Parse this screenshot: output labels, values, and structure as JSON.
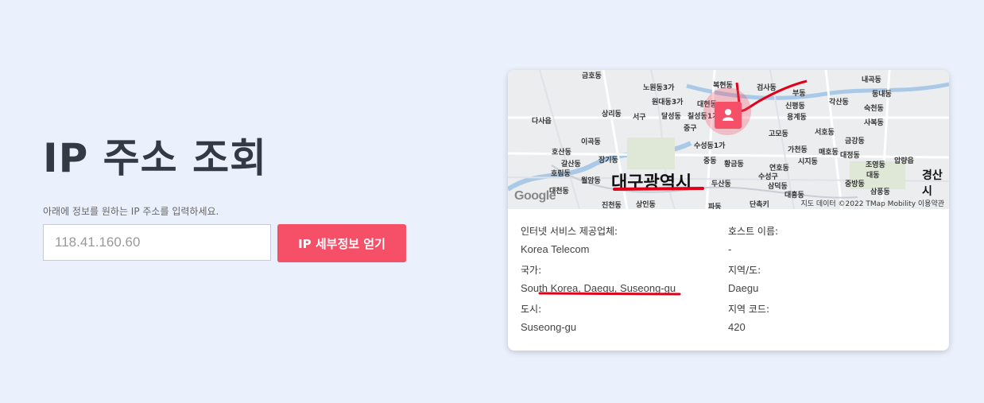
{
  "page": {
    "title": "IP 주소 조회",
    "hint": "아래에 정보를 원하는 IP 주소를 입력하세요.",
    "input_placeholder": "118.41.160.60",
    "submit_label": "IP 세부정보 얻기"
  },
  "map": {
    "city_label": "대구광역시",
    "region_label": "경산시",
    "google_text": "Google",
    "attribution": "지도 데이터 ©2022 TMap Mobility  이용약관",
    "place_labels": [
      "금호동",
      "노원동3가",
      "복현동",
      "검사동",
      "내곡동",
      "원대동3가",
      "대현동",
      "부동",
      "동내동",
      "상리동",
      "서구",
      "달성동",
      "칠성동1가",
      "신평동",
      "각산동",
      "숙천동",
      "다사읍",
      "중구",
      "용계동",
      "사복동",
      "이곡동",
      "고모동",
      "서호동",
      "호산동",
      "수성동1가",
      "가천동",
      "매호동",
      "금강동",
      "갈산동",
      "장기동",
      "중동",
      "황금동",
      "시지동",
      "대정동",
      "조영동",
      "압량읍",
      "호림동",
      "월암동",
      "연호동",
      "수성구",
      "대동",
      "대천동",
      "두산동",
      "삼덕동",
      "중방동",
      "삼풍동",
      "대흥동",
      "진천동",
      "상인동",
      "파동",
      "단촉키"
    ],
    "accent_color": "#f55067"
  },
  "info": {
    "isp_label": "인터넷 서비스 제공업체:",
    "isp_value": "Korea Telecom",
    "host_label": "호스트 이름:",
    "host_value": "-",
    "country_label": "국가:",
    "country_value": "South Korea, Daegu, Suseong-gu",
    "region_label": "지역/도:",
    "region_value": "Daegu",
    "city_label": "도시:",
    "city_value": "Suseong-gu",
    "area_code_label": "지역 코드:",
    "area_code_value": "420"
  },
  "colors": {
    "background": "#eaf0fc",
    "button": "#f55067",
    "annotation": "#e0001a"
  }
}
